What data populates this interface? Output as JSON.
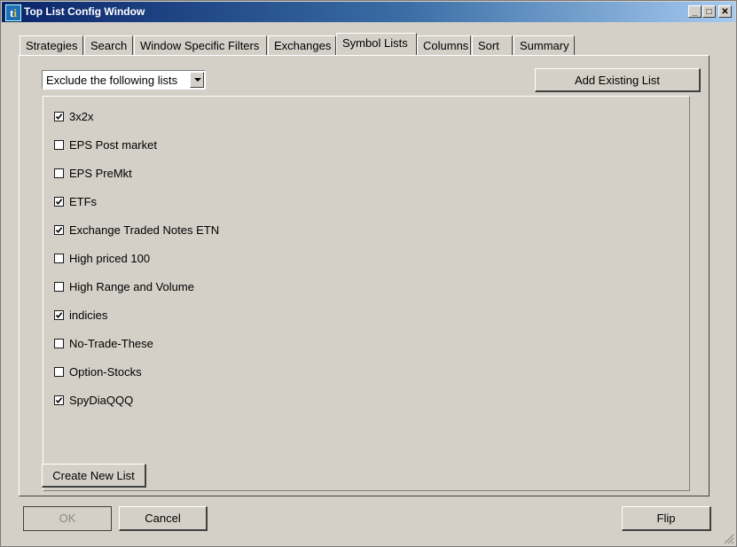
{
  "window": {
    "title": "Top List Config Window"
  },
  "title_buttons": {
    "minimize": "_",
    "maximize": "□",
    "close": "✕"
  },
  "tabs": [
    {
      "label": "Strategies"
    },
    {
      "label": "Search"
    },
    {
      "label": "Window Specific Filters"
    },
    {
      "label": "Exchanges"
    },
    {
      "label": "Symbol Lists",
      "active": true
    },
    {
      "label": "Columns"
    },
    {
      "label": "Sort"
    },
    {
      "label": "Summary"
    }
  ],
  "mode_select": {
    "value": "Exclude the following lists"
  },
  "add_existing_label": "Add Existing List",
  "lists": [
    {
      "label": "3x2x",
      "checked": true
    },
    {
      "label": "EPS Post market",
      "checked": false
    },
    {
      "label": "EPS PreMkt",
      "checked": false
    },
    {
      "label": "ETFs",
      "checked": true
    },
    {
      "label": "Exchange Traded Notes ETN",
      "checked": true
    },
    {
      "label": "High priced 100",
      "checked": false
    },
    {
      "label": "High Range and Volume",
      "checked": false
    },
    {
      "label": "indicies",
      "checked": true
    },
    {
      "label": "No-Trade-These",
      "checked": false
    },
    {
      "label": "Option-Stocks",
      "checked": false
    },
    {
      "label": "SpyDiaQQQ",
      "checked": true
    }
  ],
  "create_new_label": "Create New List",
  "footer": {
    "ok": "OK",
    "cancel": "Cancel",
    "flip": "Flip"
  }
}
